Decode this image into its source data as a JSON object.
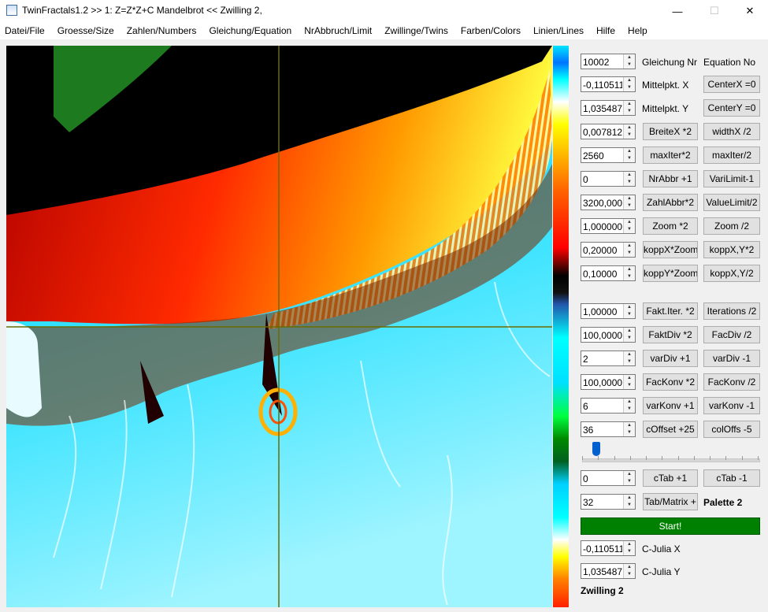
{
  "window": {
    "title": "TwinFractals1.2 >> 1: Z=Z*Z+C Mandelbrot << Zwilling 2,"
  },
  "menu": [
    "Datei/File",
    "Groesse/Size",
    "Zahlen/Numbers",
    "Gleichung/Equation",
    "NrAbbruch/Limit",
    "Zwillinge/Twins",
    "Farben/Colors",
    "Linien/Lines",
    "Hilfe",
    "Help"
  ],
  "rows_top": [
    {
      "value": "10002",
      "label": "Gleichung Nr",
      "right_label": "Equation No"
    },
    {
      "value": "-0,1105110",
      "label": "Mittelpkt. X",
      "btn2": "CenterX =0"
    },
    {
      "value": "1,03548740",
      "label": "Mittelpkt. Y",
      "btn2": "CenterY =0"
    },
    {
      "value": "0,0078125",
      "btn1": "BreiteX *2",
      "btn2": "widthX /2"
    },
    {
      "value": "2560",
      "btn1": "maxIter*2",
      "btn2": "maxIter/2"
    },
    {
      "value": "0",
      "btn1": "NrAbbr +1",
      "btn2": "VariLimit-1"
    },
    {
      "value": "3200,0000",
      "btn1": "ZahlAbbr*2",
      "btn2": "ValueLimit/2"
    },
    {
      "value": "1,0000000",
      "btn1": "Zoom *2",
      "btn2": "Zoom /2"
    },
    {
      "value": "0,20000",
      "btn1": "koppX*Zoom",
      "btn2": "koppX,Y*2"
    },
    {
      "value": "0,10000",
      "btn1": "koppY*Zoom",
      "btn2": "koppX,Y/2"
    }
  ],
  "rows_mid": [
    {
      "value": "1,00000",
      "btn1": "Fakt.Iter. *2",
      "btn2": "Iterations /2"
    },
    {
      "value": "100,00000",
      "btn1": "FaktDiv *2",
      "btn2": "FacDiv /2"
    },
    {
      "value": "2",
      "btn1": "varDiv +1",
      "btn2": "varDiv -1"
    },
    {
      "value": "100,00000",
      "btn1": "FacKonv *2",
      "btn2": "FacKonv /2"
    },
    {
      "value": "6",
      "btn1": "varKonv +1",
      "btn2": "varKonv -1"
    },
    {
      "value": "36",
      "btn1": "cOffset +25",
      "btn2": "colOffs -5"
    }
  ],
  "slider": {
    "position_fraction": 0.08
  },
  "ctab": {
    "value": "0",
    "btn1": "cTab +1",
    "btn2": "cTab -1"
  },
  "palette": {
    "value": "32",
    "btn1": "Tab/Matrix +",
    "label": "Palette 2"
  },
  "start": {
    "label": "Start!"
  },
  "julia": [
    {
      "value": "-0,1105110",
      "label": "C-Julia X"
    },
    {
      "value": "1,03548740",
      "label": "C-Julia Y"
    }
  ],
  "twin": {
    "label": "Zwilling 2"
  },
  "colors": {
    "start_button": "#008000",
    "crosshair": "#6b6b00",
    "cyan": "#00d8ff",
    "red": "#ff2000",
    "yellow": "#ffff00"
  }
}
